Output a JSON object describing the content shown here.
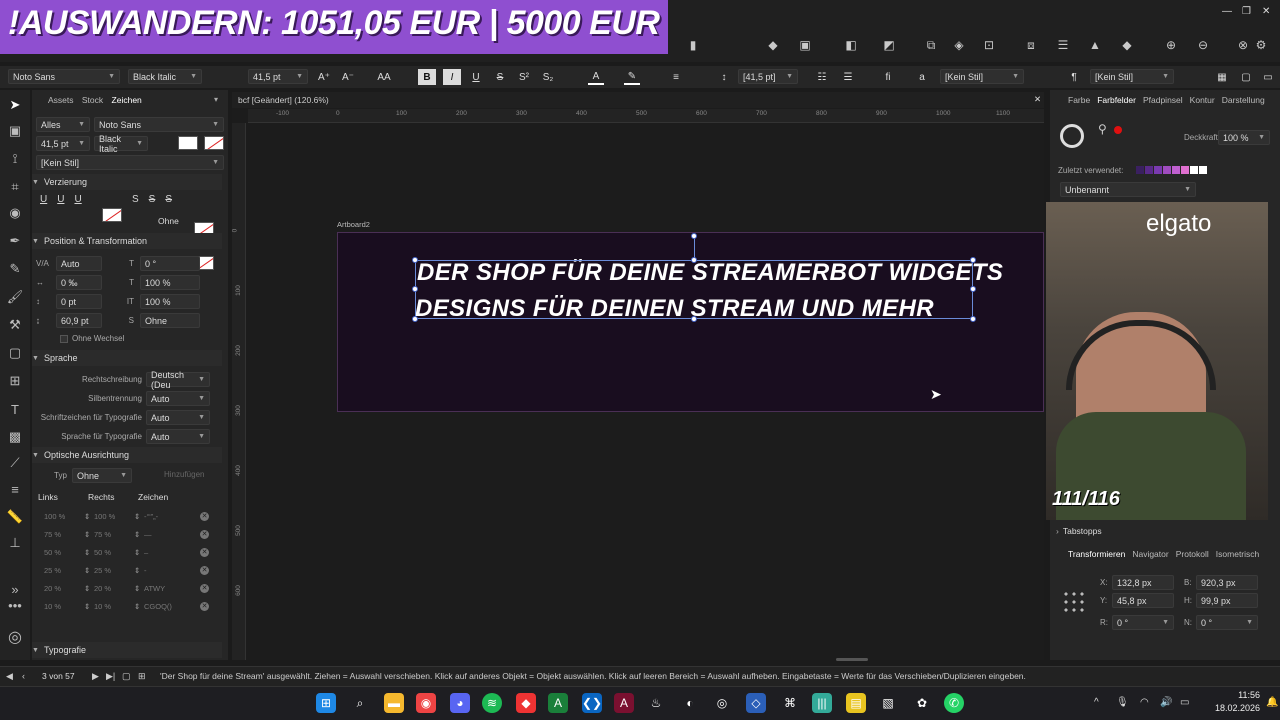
{
  "banner": {
    "text": "!AUSWANDERN: 1051,05 EUR | 5000 EUR"
  },
  "context_toolbar": {
    "font_family": "Noto Sans",
    "font_style": "Black Italic",
    "font_size": "41,5 pt",
    "leading": "[41,5 pt]",
    "char_style": "[Kein Stil]",
    "para_style": "[Kein Stil]",
    "bold": "B",
    "italic": "I",
    "underline": "U",
    "strike": "S"
  },
  "left_panel": {
    "tabs": [
      "Assets",
      "Stock",
      "Zeichen"
    ],
    "filter": "Alles",
    "font": "Noto Sans",
    "size": "41,5 pt",
    "style": "Black Italic",
    "no_style": "[Kein Stil]",
    "section_decoration": "Verzierung",
    "ohne": "Ohne",
    "section_position": "Position & Transformation",
    "pos_rows": [
      {
        "a": "Auto",
        "b": "0 °"
      },
      {
        "a": "0 ‰",
        "b": "100 %"
      },
      {
        "a": "0 pt",
        "b": "100 %"
      },
      {
        "a": "60,9 pt",
        "b": "Ohne"
      }
    ],
    "ohne_wechsel": "Ohne Wechsel",
    "section_language": "Sprache",
    "lang_rows": [
      {
        "label": "Rechtschreibung",
        "value": "Deutsch (Deu"
      },
      {
        "label": "Silbentrennung",
        "value": "Auto"
      },
      {
        "label": "Schriftzeichen für Typografie",
        "value": "Auto"
      },
      {
        "label": "Sprache für Typografie",
        "value": "Auto"
      }
    ],
    "section_optical": "Optische Ausrichtung",
    "typ_label": "Typ",
    "typ_value": "Ohne",
    "add_label": "Hinzufügen",
    "opt_headers": [
      "Links",
      "Rechts",
      "Zeichen"
    ],
    "opt_rows": [
      {
        "l": "100 %",
        "r": "100 %",
        "c": "-‘“”„-"
      },
      {
        "l": "75 %",
        "r": "75 %",
        "c": "—"
      },
      {
        "l": "50 %",
        "r": "50 %",
        "c": "–"
      },
      {
        "l": "25 %",
        "r": "25 %",
        "c": "-"
      },
      {
        "l": "20 %",
        "r": "20 %",
        "c": "ATWY"
      },
      {
        "l": "10 %",
        "r": "10 %",
        "c": "CGOQ()"
      }
    ],
    "section_typo": "Typografie"
  },
  "document": {
    "tab": "bcf [Geändert] (120.6%)",
    "artboard_label": "Artboard2",
    "line1": "DER SHOP FÜR DEINE STREAMERBOT WIDGETS",
    "line2": "DESIGNS FÜR DEINEN STREAM UND MEHR",
    "ruler_top": [
      "-100",
      "0",
      "100",
      "200",
      "300",
      "400",
      "500",
      "600",
      "700",
      "800",
      "900",
      "1000",
      "1100"
    ],
    "ruler_left": [
      "0",
      "100",
      "200",
      "300",
      "400",
      "500",
      "600"
    ]
  },
  "right_panel": {
    "tabs": [
      "Farbe",
      "Farbfelder",
      "Pfadpinsel",
      "Kontur",
      "Darstellung"
    ],
    "opacity_label": "Deckkraft:",
    "opacity": "100 %",
    "recent_label": "Zuletzt verwendet:",
    "palette": "Unbenannt",
    "tabstops": "Tabstopps",
    "tabs2": [
      "Transformieren",
      "Navigator",
      "Protokoll",
      "Isometrisch"
    ],
    "x_label": "X:",
    "x": "132,8 px",
    "y_label": "Y:",
    "y": "45,8 px",
    "w_label": "B:",
    "w": "920,3 px",
    "h_label": "H:",
    "h": "99,9 px",
    "r_label": "R:",
    "r": "0 °",
    "s_label": "N:",
    "s": "0 °"
  },
  "webcam": {
    "logo": "elgato",
    "counter": "111/116"
  },
  "status": {
    "pages": "3 von 57",
    "text": "'Der Shop für deine Stream' ausgewählt. Ziehen = Auswahl verschieben. Klick auf anderes Objekt = Objekt auswählen. Klick auf leeren Bereich = Auswahl aufheben. Eingabetaste = Werte für das Verschieben/Duplizieren eingeben."
  },
  "clock": {
    "time": "11:56",
    "date": "18.02.2026"
  },
  "colors": {
    "accent": "#8f4fd0",
    "artboard": "#190d1f"
  }
}
